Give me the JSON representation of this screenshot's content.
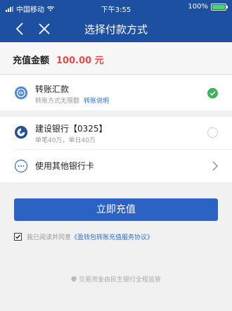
{
  "status_bar": {
    "carrier": "中国移动",
    "time": "下午3:55",
    "battery_text": "100%"
  },
  "nav": {
    "title": "选择付款方式",
    "back_icon": "chevron-left-icon",
    "close_icon": "close-icon"
  },
  "amount": {
    "label": "充值金额",
    "value": "100.00 元"
  },
  "payment_options": [
    {
      "title": "转账汇款",
      "subtitle": "转账方式无限额",
      "link": "转账说明",
      "selected": true
    },
    {
      "title": "建设银行【0325】",
      "subtitle": "单笔40万，单日40万",
      "selected": false
    },
    {
      "title": "使用其他银行卡"
    }
  ],
  "recharge_button": "立即充值",
  "agreement": {
    "prefix": "我已阅读并同意",
    "link": "《盈钱包转账充值服务协议》",
    "checked": true
  },
  "footer_note": "交易资金由民生银行全程监管",
  "colors": {
    "primary": "#1e50a2",
    "button": "#2b63c4",
    "accent_red": "#e34a4a",
    "selected_green": "#3fb35b"
  }
}
